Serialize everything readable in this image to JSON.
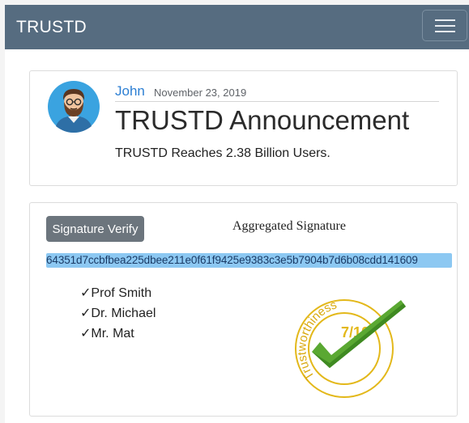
{
  "navbar": {
    "brand": "TRUSTD",
    "menu_icon": "hamburger-menu-icon"
  },
  "post": {
    "author": "John",
    "date": "November 23, 2019",
    "title": "TRUSTD Announcement",
    "body": "TRUSTD Reaches 2.38 Billion Users.",
    "avatar_icon": "bearded-man-avatar"
  },
  "signature": {
    "verify_label": "Signature Verify",
    "aggregated_label": "Aggregated Signature",
    "hash": "64351d7ccbfbea225dbee211e0f61f9425e9383c3e5b7904b7d6b08cdd141609",
    "signers": [
      "✓Prof Smith",
      "✓Dr. Michael",
      "✓Mr. Mat"
    ],
    "badge": {
      "label": "Trustworthiness",
      "score": "7/10",
      "icon": "checkmark-icon"
    }
  },
  "colors": {
    "navbar": "#566c80",
    "link": "#2c7fd3",
    "button": "#6c757d",
    "hash_highlight": "#8cc8f2",
    "badge_gold": "#e3b81a",
    "check_green": "#5aa832"
  }
}
